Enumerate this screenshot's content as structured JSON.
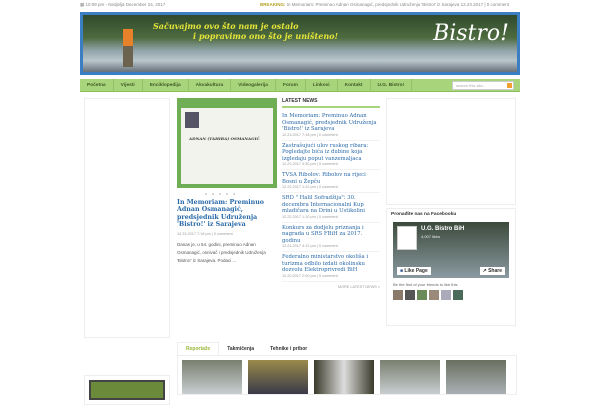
{
  "topbar": {
    "datetime": "10:09 pm - Nedjelja December 24, 2017",
    "breaking_label": "BREAKING:",
    "breaking_text": "In Memoriam: Preminuo Adnan Osmanagić, predsjednik Udruženja 'Bistro!' iz Sarajeva",
    "breaking_date": "12.23.2017",
    "breaking_comments": "0 comment"
  },
  "banner": {
    "slogan1": "Sačuvajmo ovo što nam je ostalo",
    "slogan2": "i popravimo ono što je uništeno!",
    "logo": "Bistro!"
  },
  "nav": {
    "items": [
      "Početna",
      "Vijesti",
      "Enciklopedija",
      "Akvakultura",
      "Videogalerija",
      "Forum",
      "Linkovi",
      "Kontakt",
      "U.G. Bistro!"
    ],
    "search_placeholder": "search this site..."
  },
  "featured": {
    "card_name": "ADNAN (TAHIRA) OSMANAGIĆ",
    "title": "In Memoriam: Preminuo Adnan Osmanagić, predsjednik Udruženja 'Bistro!' iz Sarajeva",
    "date": "12.23.2017 7:18 pm",
    "comments": "0 comment",
    "excerpt": "Danas je, u 54. godini, preminuo Adnan Osmanagić, osnivač i predsjednik Udruženja 'Bistro!' iz Sarajeva. Podaci ..."
  },
  "latest": {
    "heading": "LATEST NEWS",
    "items": [
      {
        "title": "In Memoriam: Preminuo Adnan Osmanagić, predsjednik Udruženja 'Bistro!' iz Sarajeva",
        "date": "12.23.2017 7:18 pm",
        "comments": "0 comment"
      },
      {
        "title": "Zastrašujući ulov ruskog ribara: Pogledajte bića iz dubine koja izgledaju poput vanzemaljaca",
        "date": "12.22.2017 4:30 pm",
        "comments": "0 comment"
      },
      {
        "title": "TVSA Ribolov: Ribolov na rijeci Bosni u Žepču",
        "date": "12.22.2017 1:22 pm",
        "comments": "0 comment"
      },
      {
        "title": "SRD \" Halil Sofradžija\": 30. decembra Internacionalni Kup mladičara na Drini u Ustikolini",
        "date": "12.22.2017 1:10 pm",
        "comments": "0 comment"
      },
      {
        "title": "Konkurs za dodjelu priznanja i nagrada u SRS FBiH za 2017. godinu",
        "date": "12.21.2017 4:12 pm",
        "comments": "0 comment"
      },
      {
        "title": "Federalno ministarstvo okoliša i turizma odbilo izdati okolinsku dozvolu Elektroprivredi BiH",
        "date": "12.20.2017 2:00 pm",
        "comments": "0 comment"
      }
    ],
    "more": "MORE LATEST NEWS »"
  },
  "facebook": {
    "heading": "Pronađite nas na Facebooku",
    "page_name": "U.G. Bistro BiH",
    "likes": "4,007 likes",
    "like_btn": "Like Page",
    "share_btn": "Share",
    "friends_text": "Be the first of your friends to like this"
  },
  "tabs": [
    "Reportaže",
    "Takmičenja",
    "Tehnike i pribor"
  ]
}
